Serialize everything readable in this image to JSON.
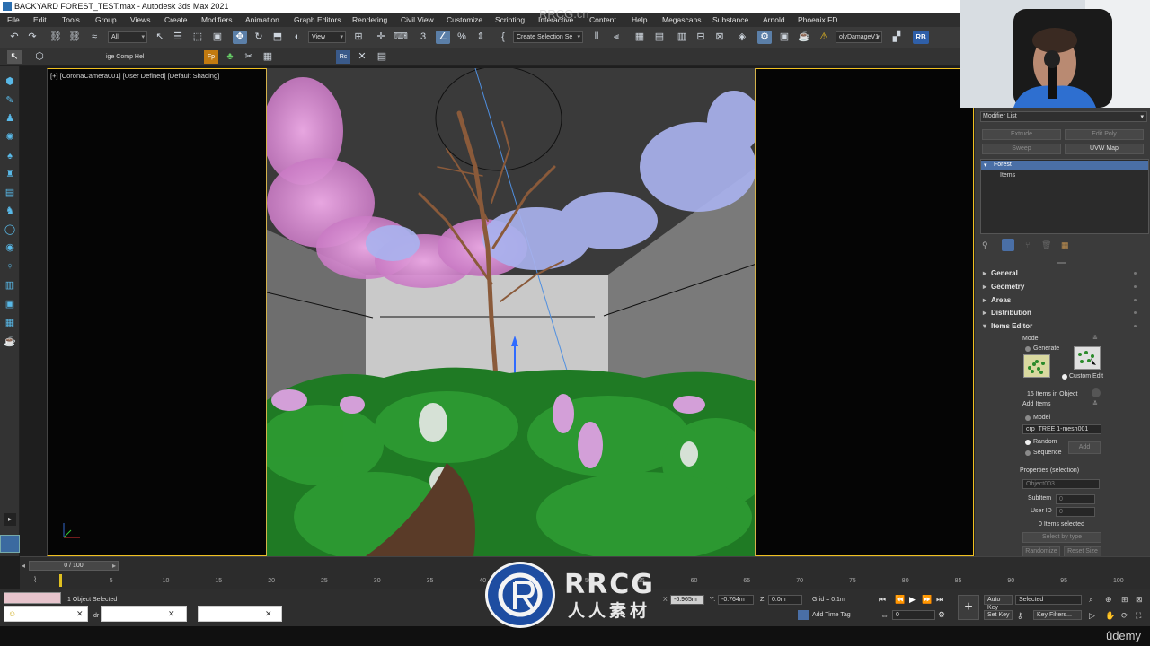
{
  "window": {
    "title": "BACKYARD FOREST_TEST.max - Autodesk 3ds Max 2021"
  },
  "menu": [
    "File",
    "Edit",
    "Tools",
    "Group",
    "Views",
    "Create",
    "Modifiers",
    "Animation",
    "Graph Editors",
    "Rendering",
    "Civil View",
    "Customize",
    "Scripting",
    "Interactive",
    "Content",
    "Help",
    "Megascans",
    "Substance",
    "Arnold",
    "Phoenix FD"
  ],
  "toolbar": {
    "selection_filter": "All",
    "ref_coord": "View",
    "named_selection": "Create Selection Se",
    "workspace": "olyDamageV1",
    "rb_label": "RB"
  },
  "toolbar2": {
    "comp_label": "ige Comp Hel"
  },
  "viewport": {
    "label": "[+] [CoronaCamera001] [User Defined] [Default Shading]"
  },
  "modifier_panel": {
    "modifier_list": "Modifier List",
    "buttons": [
      "Extrude",
      "Edit Poly",
      "Sweep",
      "UVW Map"
    ],
    "stack": [
      "Forest",
      "Items"
    ]
  },
  "rollouts": [
    "General",
    "Geometry",
    "Areas",
    "Distribution",
    "Items Editor"
  ],
  "items_editor": {
    "mode_label": "Mode",
    "generate_label": "Generate",
    "custom_edit_label": "Custom Edit",
    "items_count": "16 Items in Object",
    "add_items_label": "Add Items",
    "model_label": "Model",
    "model_value": "crp_TREE 1-mesh001",
    "random_label": "Random",
    "sequence_label": "Sequence",
    "add_button": "Add",
    "properties_label": "Properties (selection)",
    "object_value": "Object003",
    "subitem_label": "SubItem",
    "subitem_value": "0",
    "userid_label": "User ID",
    "userid_value": "0",
    "selected_count": "0 Items selected",
    "select_by_type": "Select by type",
    "randomize": "Randomize",
    "reset_size": "Reset Size"
  },
  "timeline": {
    "frame_readout": "0 / 100",
    "ticks": [
      "5",
      "10",
      "15",
      "20",
      "25",
      "30",
      "35",
      "40",
      "45",
      "50",
      "55",
      "60",
      "65",
      "70",
      "75",
      "80",
      "85",
      "90",
      "95",
      "100"
    ]
  },
  "status": {
    "selection_info": "1 Object Selected",
    "x_label": "X:",
    "x_value": "-6.965m",
    "y_label": "Y:",
    "y_value": "-0.764m",
    "z_label": "Z:",
    "z_value": "0.0m",
    "grid": "Grid = 0.1m",
    "add_time_tag": "Add Time Tag",
    "auto_key": "Auto Key",
    "set_key": "Set Key",
    "key_mode": "Selected",
    "key_filters": "Key Filters...",
    "frame_field": "0"
  },
  "watermarks": {
    "top": "RRCG.cn",
    "brand": "RRCG",
    "brand_cn": "人人素材",
    "udemy": "ûdemy"
  },
  "colors": {
    "accent": "#5b7fa8",
    "viewport_border": "#f0c020",
    "icon_blue": "#59b9e8"
  }
}
